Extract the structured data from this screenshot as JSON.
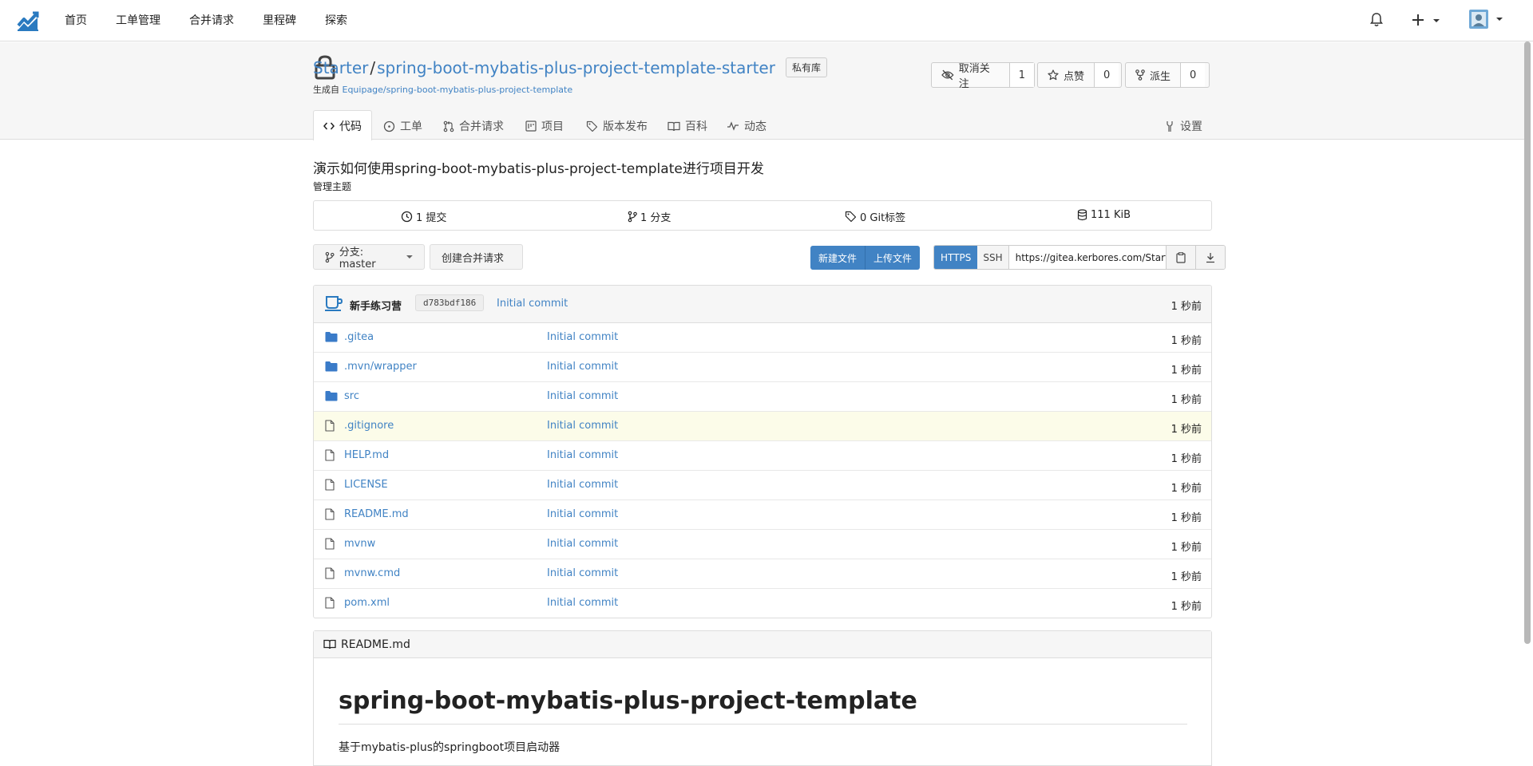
{
  "nav": {
    "items": [
      "首页",
      "工单管理",
      "合并请求",
      "里程碑",
      "探索"
    ]
  },
  "repo": {
    "owner": "Starter",
    "separator": "/",
    "name": "spring-boot-mybatis-plus-project-template-starter",
    "private_badge": "私有库",
    "generated_from_label": "生成自",
    "generated_from": "Equipage/spring-boot-mybatis-plus-project-template"
  },
  "actions": {
    "unwatch_label": "取消关注",
    "watch_count": "1",
    "star_label": "点赞",
    "star_count": "0",
    "fork_label": "派生",
    "fork_count": "0"
  },
  "tabs": {
    "code": "代码",
    "issues": "工单",
    "pulls": "合并请求",
    "projects": "项目",
    "releases": "版本发布",
    "wiki": "百科",
    "activity": "动态",
    "settings": "设置"
  },
  "description": "演示如何使用spring-boot-mybatis-plus-project-template进行项目开发",
  "manage_topics": "管理主题",
  "stats": {
    "commits": "1 提交",
    "branches": "1 分支",
    "tags": "0 Git标签",
    "size": "111 KiB"
  },
  "branch": {
    "label": "分支: master",
    "new_pr": "创建合并请求",
    "new_file": "新建文件",
    "upload_file": "上传文件"
  },
  "clone": {
    "https": "HTTPS",
    "ssh": "SSH",
    "url": "https://gitea.kerbores.com/Starter/spring-boot-mybatis-plus-project-template-starter.git"
  },
  "latest_commit": {
    "author": "新手练习营",
    "sha": "d783bdf186",
    "message": "Initial commit",
    "age": "1 秒前"
  },
  "files": [
    {
      "name": ".gitea",
      "type": "folder",
      "commit": "Initial commit",
      "age": "1 秒前"
    },
    {
      "name": ".mvn/wrapper",
      "type": "folder",
      "commit": "Initial commit",
      "age": "1 秒前"
    },
    {
      "name": "src",
      "type": "folder",
      "commit": "Initial commit",
      "age": "1 秒前"
    },
    {
      "name": ".gitignore",
      "type": "file",
      "commit": "Initial commit",
      "age": "1 秒前"
    },
    {
      "name": "HELP.md",
      "type": "file",
      "commit": "Initial commit",
      "age": "1 秒前"
    },
    {
      "name": "LICENSE",
      "type": "file",
      "commit": "Initial commit",
      "age": "1 秒前"
    },
    {
      "name": "README.md",
      "type": "file",
      "commit": "Initial commit",
      "age": "1 秒前"
    },
    {
      "name": "mvnw",
      "type": "file",
      "commit": "Initial commit",
      "age": "1 秒前"
    },
    {
      "name": "mvnw.cmd",
      "type": "file",
      "commit": "Initial commit",
      "age": "1 秒前"
    },
    {
      "name": "pom.xml",
      "type": "file",
      "commit": "Initial commit",
      "age": "1 秒前"
    }
  ],
  "readme": {
    "filename": "README.md",
    "heading": "spring-boot-mybatis-plus-project-template",
    "intro": "基于mybatis-plus的springboot项目启动器"
  },
  "colors": {
    "link": "#4183c4",
    "primary": "#4183c4",
    "highlight_row": "#fcfce9"
  }
}
